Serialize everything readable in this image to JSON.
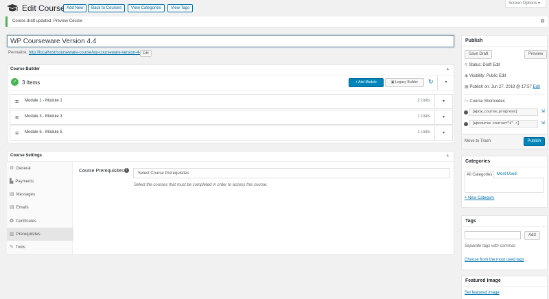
{
  "header": {
    "title": "Edit Course",
    "buttons": [
      "Add New",
      "Back to Courses",
      "View Categories",
      "View Tags"
    ],
    "screen_options": "Screen Options"
  },
  "notice": {
    "text": "Course draft updated. Preview Course"
  },
  "editor": {
    "title_value": "WP Courseware Version 4.4",
    "permalink_label": "Permalink:",
    "permalink_url": "http://localhost/courseware-course/wp-courseware-version-4-4/",
    "permalink_edit": "Edit"
  },
  "course_builder": {
    "title": "Course Builder",
    "item_count": "3 Items",
    "add_module": "+ Add Module",
    "legacy_builder": "Legacy Builder",
    "modules": [
      {
        "title": "Module 1 - Module 1",
        "units": "2 Units"
      },
      {
        "title": "Module 3 - Module 3",
        "units": "1 Units"
      },
      {
        "title": "Module 5 - Module 5",
        "units": "1 Units"
      }
    ]
  },
  "course_settings": {
    "title": "Course Settings",
    "tabs": [
      {
        "label": "General",
        "icon": "gear-icon"
      },
      {
        "label": "Payments",
        "icon": "cart-icon"
      },
      {
        "label": "Messages",
        "icon": "email-icon"
      },
      {
        "label": "Emails",
        "icon": "email-icon"
      },
      {
        "label": "Certificates",
        "icon": "certificate-icon"
      },
      {
        "label": "Prerequisites",
        "icon": "lock-icon"
      },
      {
        "label": "Tools",
        "icon": "wrench-icon"
      }
    ],
    "active_tab": "Prerequisites",
    "prereq_label": "Course Prerequisites",
    "prereq_placeholder": "Select Course Prerequisites",
    "prereq_help": "Select the courses that must be completed in order to access this course."
  },
  "publish": {
    "title": "Publish",
    "save_draft": "Save Draft",
    "preview": "Preview",
    "status": "Status: Draft Edit",
    "visibility": "Visibility: Public Edit",
    "publish_on": "Publish on: Jun 27, 2018 @ 17:57",
    "publish_on_edit": "Edit",
    "shortcodes_title": "Course Shortcodes",
    "shortcode_1": "[wpcw_course_progress]",
    "shortcode_2": "[wpcourse course=\"1\" /]",
    "move_to_trash": "Move to Trash",
    "publish_button": "Publish"
  },
  "categories": {
    "title": "Categories",
    "tab_all": "All Categories",
    "tab_most_used": "Most Used",
    "add_new": "+ New Category"
  },
  "tags": {
    "title": "Tags",
    "add_button": "Add",
    "help": "Separate tags with commas",
    "choose": "Choose from the most used tags"
  },
  "featured_image": {
    "title": "Featured Image",
    "set_link": "Set featured image"
  },
  "colors": {
    "accent": "#0073aa",
    "primary_button": "#0085ba",
    "notice_border": "#46b450"
  }
}
